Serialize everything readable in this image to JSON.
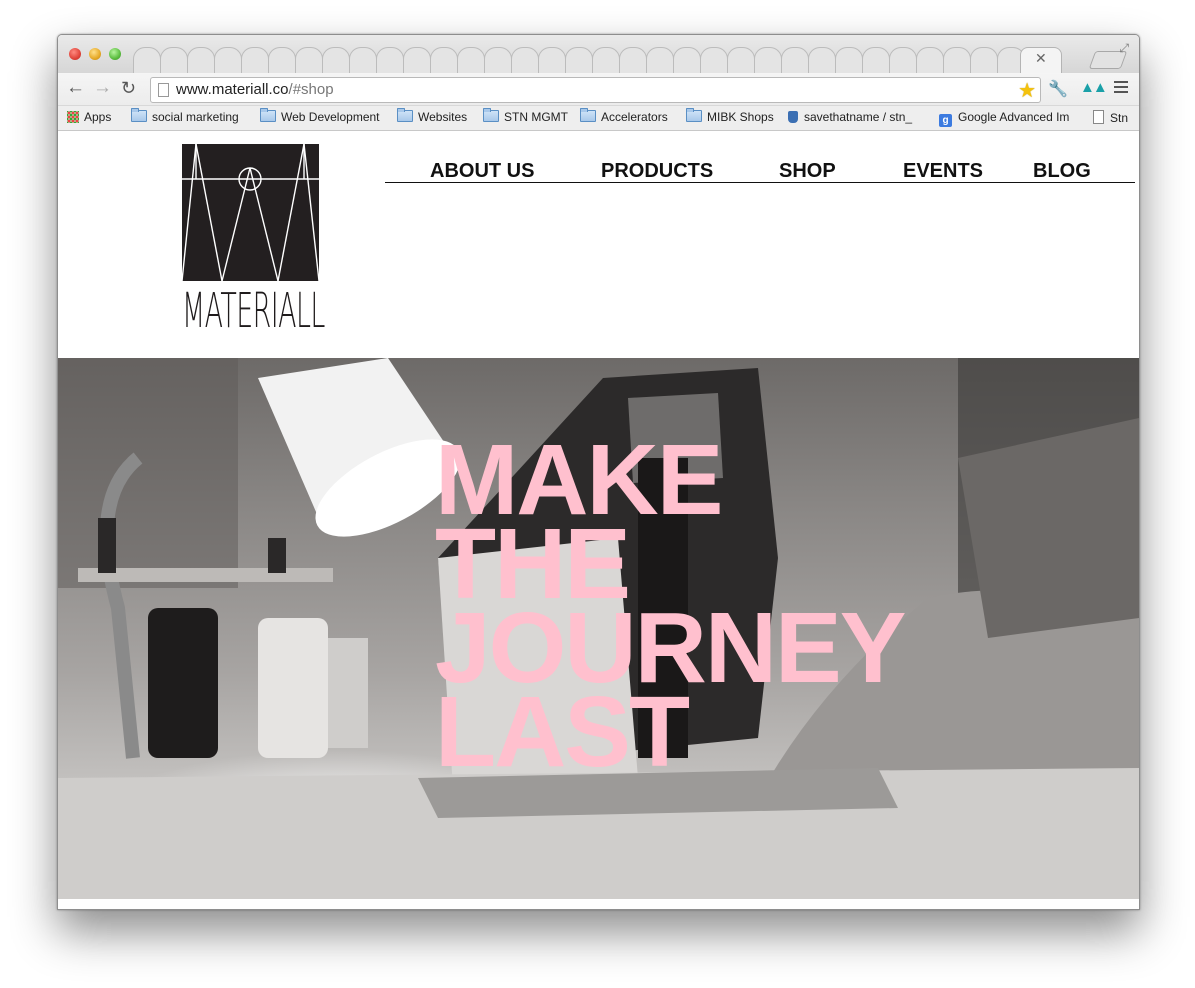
{
  "browser": {
    "url_host": "www.materiall.co",
    "url_path": "/#shop",
    "bookmarks": [
      {
        "label": "Apps",
        "icon": "apps-grid-icon"
      },
      {
        "label": "social marketing",
        "icon": "folder-icon"
      },
      {
        "label": "Web Development",
        "icon": "folder-icon"
      },
      {
        "label": "Websites",
        "icon": "folder-icon"
      },
      {
        "label": "STN MGMT",
        "icon": "folder-icon"
      },
      {
        "label": "Accelerators",
        "icon": "folder-icon"
      },
      {
        "label": "MIBK Shops",
        "icon": "folder-icon"
      },
      {
        "label": "savethatname / stn_",
        "icon": "bitbucket-icon"
      },
      {
        "label": "Google Advanced Im",
        "icon": "google-icon"
      },
      {
        "label": "Stn",
        "icon": "document-icon"
      }
    ]
  },
  "site": {
    "logo_text": "MATERIALL",
    "nav": [
      "ABOUT US",
      "PRODUCTS",
      "SHOP",
      "EVENTS",
      "BLOG"
    ],
    "hero_lines": [
      "MAKE",
      "THE",
      "JOURNEY",
      "LAST"
    ],
    "hero_color": "#ffc0ce"
  }
}
